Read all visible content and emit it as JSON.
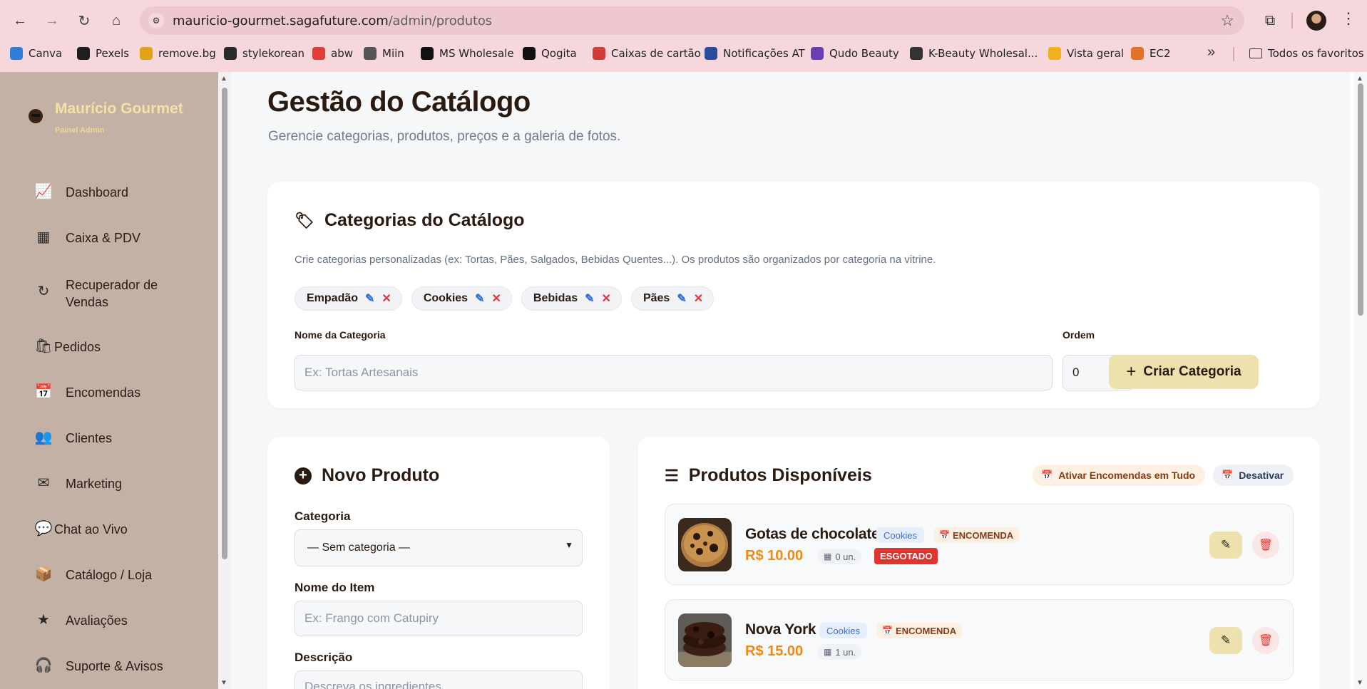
{
  "browser": {
    "url_host": "mauricio-gourmet.sagafuture.com",
    "url_path": "/admin/produtos",
    "bookmarks": [
      {
        "label": "Canva",
        "icon": "canva-icon",
        "color": "#2f7dd6"
      },
      {
        "label": "Pexels",
        "icon": "pexels-icon",
        "color": "#1f1f1f"
      },
      {
        "label": "remove.bg",
        "icon": "removebg-icon",
        "color": "#e0a416"
      },
      {
        "label": "stylekorean",
        "icon": "stylekorean-icon",
        "color": "#2b2b2b"
      },
      {
        "label": "abw",
        "icon": "abw-icon",
        "color": "#e23b3b"
      },
      {
        "label": "Miin",
        "icon": "miin-icon",
        "color": "#555555"
      },
      {
        "label": "MS Wholesale",
        "icon": "ms-icon",
        "color": "#111111"
      },
      {
        "label": "Qogita",
        "icon": "qogita-icon",
        "color": "#111111"
      },
      {
        "label": "Caixas de cartão",
        "icon": "caixas-icon",
        "color": "#d23a3a"
      },
      {
        "label": "Notificações AT",
        "icon": "at-icon",
        "color": "#2a4e9e"
      },
      {
        "label": "Qudo Beauty",
        "icon": "qudo-icon",
        "color": "#6a3fb5"
      },
      {
        "label": "K-Beauty Wholesal...",
        "icon": "globe-icon",
        "color": "#333333"
      },
      {
        "label": "Vista geral",
        "icon": "ads-icon",
        "color": "#f2b01e"
      },
      {
        "label": "EC2",
        "icon": "ec2-icon",
        "color": "#e2712a"
      }
    ],
    "all_bookmarks": "Todos os favoritos"
  },
  "sidebar": {
    "brand_name": "Maurício Gourmet",
    "brand_sub": "Painel Admin",
    "items": [
      {
        "label": "Dashboard",
        "icon": "chart-line-icon"
      },
      {
        "label": "Caixa & PDV",
        "icon": "cash-register-icon"
      },
      {
        "label": "Recuperador de Vendas",
        "icon": "redo-icon"
      },
      {
        "label": "Pedidos",
        "icon": "shopping-bag-icon"
      },
      {
        "label": "Encomendas",
        "icon": "calendar-icon"
      },
      {
        "label": "Clientes",
        "icon": "users-icon"
      },
      {
        "label": "Marketing",
        "icon": "envelope-icon"
      },
      {
        "label": "Chat ao Vivo",
        "icon": "chat-icon"
      },
      {
        "label": "Catálogo / Loja",
        "icon": "box-open-icon"
      },
      {
        "label": "Avaliações",
        "icon": "star-icon"
      },
      {
        "label": "Suporte & Avisos",
        "icon": "headset-icon"
      }
    ]
  },
  "main": {
    "title": "Gestão do Catálogo",
    "subtitle": "Gerencie categorias, produtos, preços e a galeria de fotos.",
    "categories": {
      "heading": "Categorias do Catálogo",
      "description": "Crie categorias personalizadas (ex: Tortas, Pães, Salgados, Bebidas Quentes...). Os produtos são organizados por categoria na vitrine.",
      "chips": [
        "Empadão",
        "Cookies",
        "Bebidas",
        "Pães"
      ],
      "name_label": "Nome da Categoria",
      "name_placeholder": "Ex: Tortas Artesanais",
      "order_label": "Ordem",
      "order_value": "0",
      "create_button": "Criar Categoria"
    },
    "new_product": {
      "heading": "Novo Produto",
      "category_label": "Categoria",
      "category_selected": "— Sem categoria —",
      "name_label": "Nome do Item",
      "name_placeholder": "Ex: Frango com Catupiry",
      "desc_label": "Descrição",
      "desc_placeholder": "Descreva os ingredientes..."
    },
    "products": {
      "heading": "Produtos Disponíveis",
      "activate_button": "Ativar Encomendas em Tudo",
      "deactivate_button": "Desativar",
      "items": [
        {
          "name": "Gotas de chocolate",
          "category": "Cookies",
          "order_tag": "ENCOMENDA",
          "price": "R$ 10.00",
          "stock": "0 un.",
          "sold_out": "ESGOTADO"
        },
        {
          "name": "Nova York",
          "category": "Cookies",
          "order_tag": "ENCOMENDA",
          "price": "R$ 15.00",
          "stock": "1 un.",
          "sold_out": ""
        }
      ]
    }
  }
}
